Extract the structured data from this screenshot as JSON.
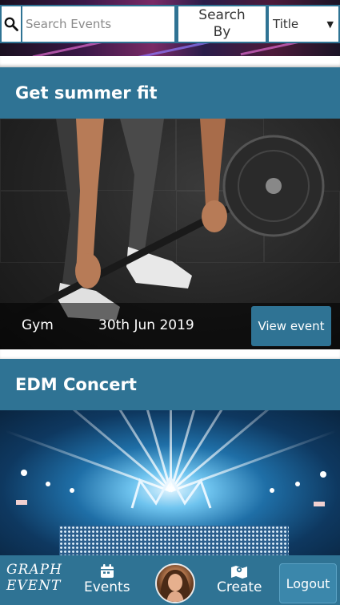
{
  "search": {
    "placeholder": "Search Events",
    "search_by_label": "Search By",
    "selected_field": "Title"
  },
  "events": [
    {
      "title": "Get summer fit",
      "category": "Gym",
      "date": "30th Jun 2019",
      "action_label": "View event"
    },
    {
      "title": "EDM Concert"
    }
  ],
  "nav": {
    "brand_line1": "GRAPH",
    "brand_line2": "EVENT",
    "events_label": "Events",
    "create_label": "Create",
    "logout_label": "Logout"
  },
  "colors": {
    "primary": "#2f7394",
    "header_text": "#ffffff"
  }
}
